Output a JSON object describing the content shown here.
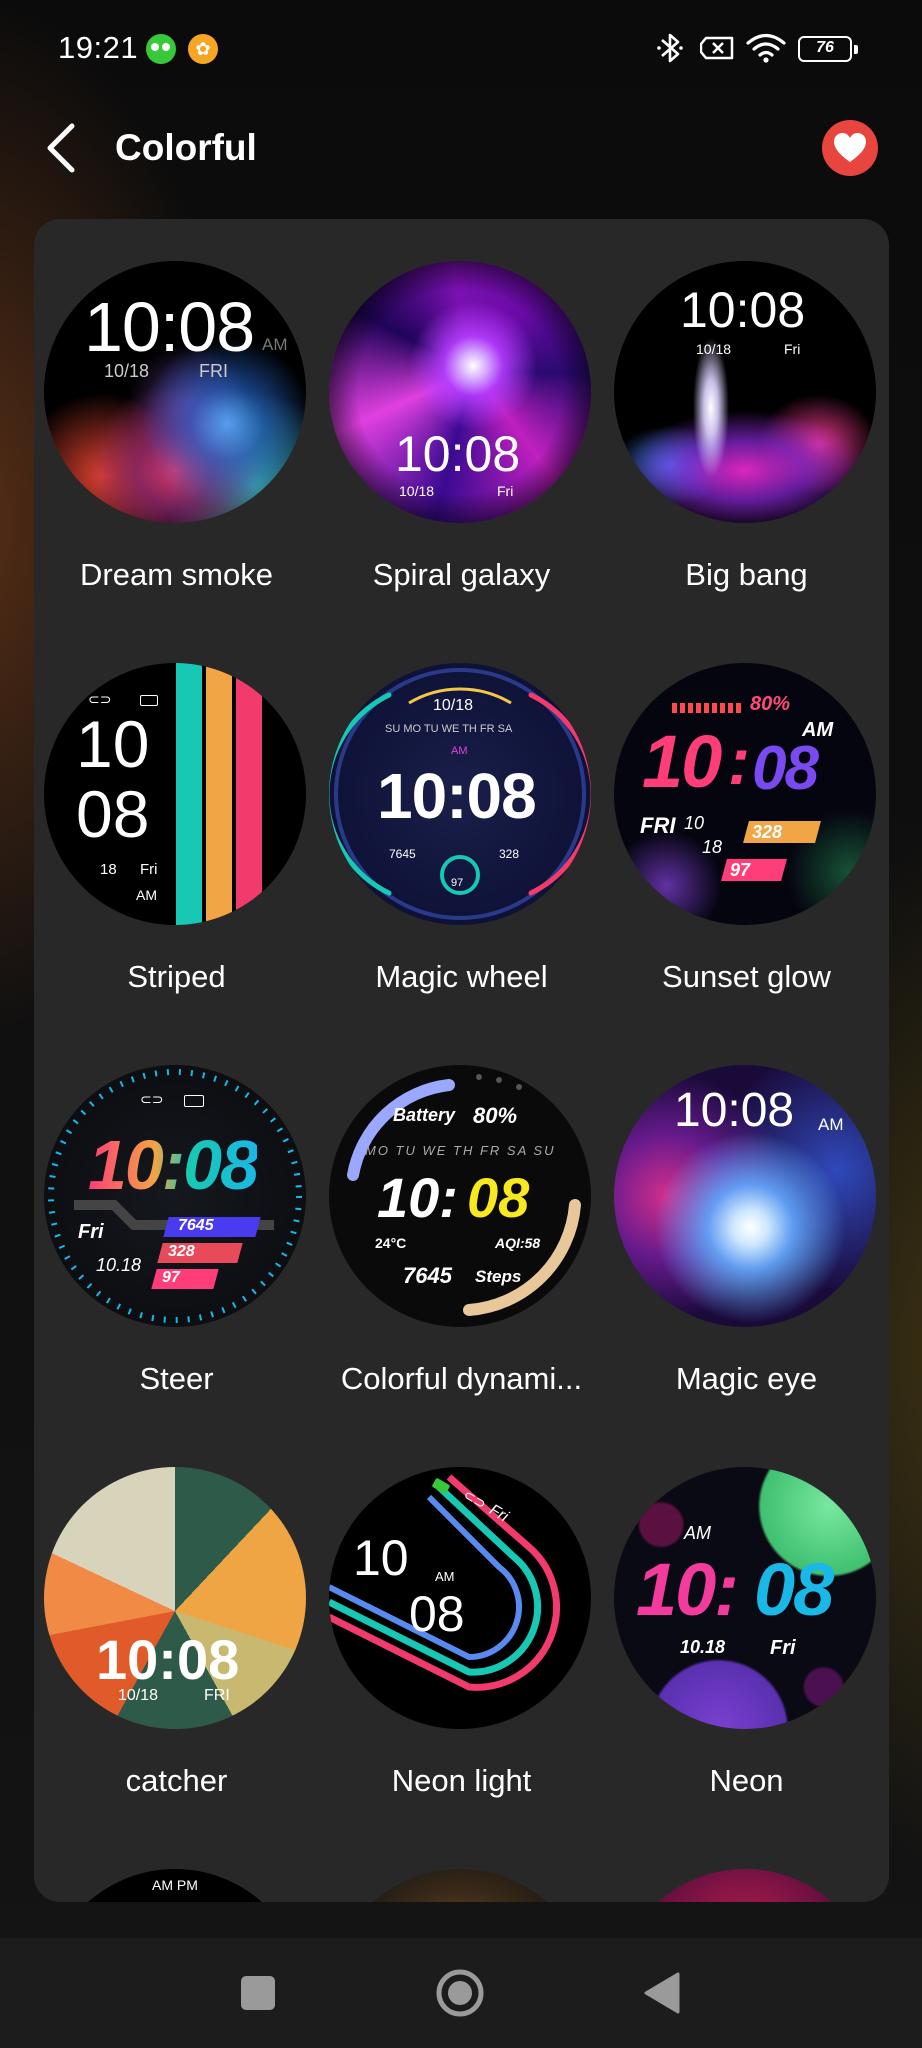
{
  "status_bar": {
    "time": "19:21",
    "battery": "76"
  },
  "header": {
    "title": "Colorful"
  },
  "faces": [
    {
      "name": "Dream smoke",
      "time": "10:08",
      "ampm": "AM",
      "date": "10/18",
      "day": "FRI"
    },
    {
      "name": "Spiral galaxy",
      "time": "10:08",
      "date": "10/18",
      "day": "Fri"
    },
    {
      "name": "Big bang",
      "time": "10:08",
      "date": "10/18",
      "day": "Fri"
    },
    {
      "name": "Striped",
      "hour": "10",
      "minute": "08",
      "date": "18",
      "day": "Fri",
      "ampm": "AM"
    },
    {
      "name": "Magic wheel",
      "time": "10:08",
      "date": "10/18",
      "weekdays": "SU MO TU WE TH FR SA",
      "ampm": "AM",
      "steps": "7645",
      "calories": "328",
      "heart": "97"
    },
    {
      "name": "Sunset glow",
      "hour": "10",
      "minute": "08",
      "battery": "80%",
      "ampm": "AM",
      "day": "FRI",
      "date1": "10",
      "date2": "18",
      "calories": "328",
      "heart": "97"
    },
    {
      "name": "Steer",
      "time": "10:08",
      "day": "Fri",
      "date": "10.18",
      "steps": "7645",
      "calories": "328",
      "heart": "97"
    },
    {
      "name": "Colorful dynami...",
      "battery_label": "Battery",
      "battery": "80%",
      "weekdays": "MO TU WE TH FR SA SU",
      "hour": "10:",
      "minute": "08",
      "temp": "24°C",
      "aqi": "AQI:58",
      "steps": "7645",
      "steps_label": "Steps"
    },
    {
      "name": "Magic eye",
      "time": "10:08",
      "ampm": "AM"
    },
    {
      "name": "catcher",
      "time": "10:08",
      "date": "10/18",
      "day": "FRI"
    },
    {
      "name": "Neon light",
      "hour": "10",
      "minute": "08",
      "ampm": "AM",
      "day": "Fri"
    },
    {
      "name": "Neon",
      "hour": "10:",
      "minute": "08",
      "ampm": "AM",
      "date": "10.18",
      "day": "Fri"
    }
  ],
  "peek": {
    "ampm": "AM PM"
  },
  "colors": {
    "accent_red": "#e8453f",
    "card_bg": "#282828",
    "background": "#111111"
  },
  "icons": [
    "back-arrow-icon",
    "heart-icon",
    "bluetooth-icon",
    "sim-icon",
    "wifi-icon",
    "battery-icon",
    "square-nav-icon",
    "home-nav-icon",
    "back-nav-icon"
  ]
}
